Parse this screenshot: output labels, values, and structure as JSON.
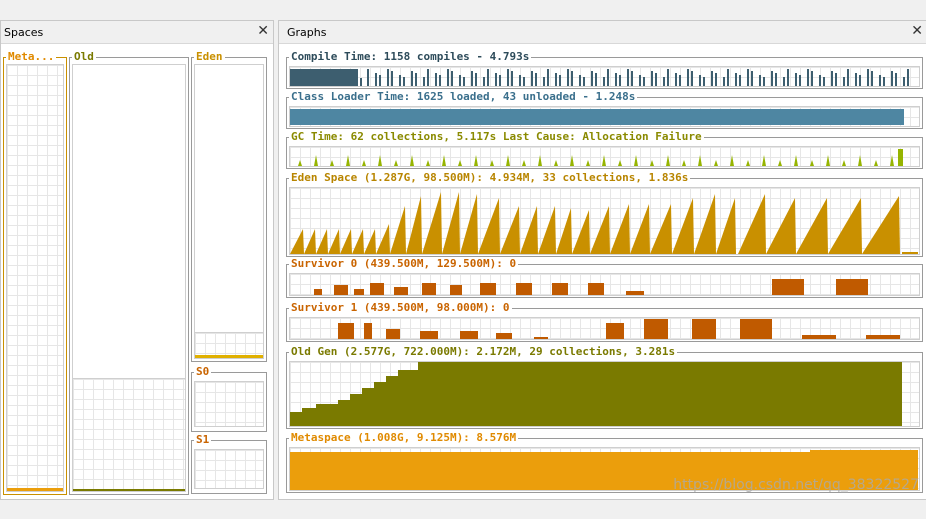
{
  "spaces_pane": {
    "title": "Spaces",
    "close_glyph": "✕",
    "meta_label": "Meta...",
    "old_label": "Old",
    "eden_label": "Eden",
    "s0_label": "S0",
    "s1_label": "S1",
    "meta_fill": 0.01,
    "old_fill": 0.005,
    "eden_fill": 0.01
  },
  "graphs_pane": {
    "title": "Graphs",
    "close_glyph": "✕",
    "compile": {
      "label": "Compile Time: 1158 compiles - 4.793s",
      "color": "#3d5e6f"
    },
    "classloader": {
      "label": "Class Loader Time: 1625 loaded, 43 unloaded - 1.248s",
      "color": "#4e86a2"
    },
    "gc": {
      "label": "GC Time: 62 collections, 5.117s  Last Cause: Allocation Failure",
      "color": "#96b400"
    },
    "eden": {
      "label": "Eden Space (1.287G, 98.500M): 4.934M, 33 collections, 1.836s",
      "color": "#c99000"
    },
    "survivor0": {
      "label": "Survivor 0 (439.500M, 129.500M): 0",
      "color": "#c05a00"
    },
    "survivor1": {
      "label": "Survivor 1 (439.500M, 98.000M): 0",
      "color": "#c05a00"
    },
    "oldgen": {
      "label": "Old Gen (2.577G, 722.000M): 2.172M, 29 collections, 3.281s",
      "color": "#7a7a00"
    },
    "metaspace": {
      "label": "Metaspace (1.008G, 9.125M): 8.576M",
      "color": "#eb9e0c"
    }
  },
  "colors": {
    "label_gold": "#b88500",
    "label_blue": "#3a6f8c",
    "label_olive": "#8a8a00",
    "label_orange": "#c96400",
    "label_compile": "#2d4b5a"
  },
  "watermark": "https://blog.csdn.net/qq_38322527"
}
